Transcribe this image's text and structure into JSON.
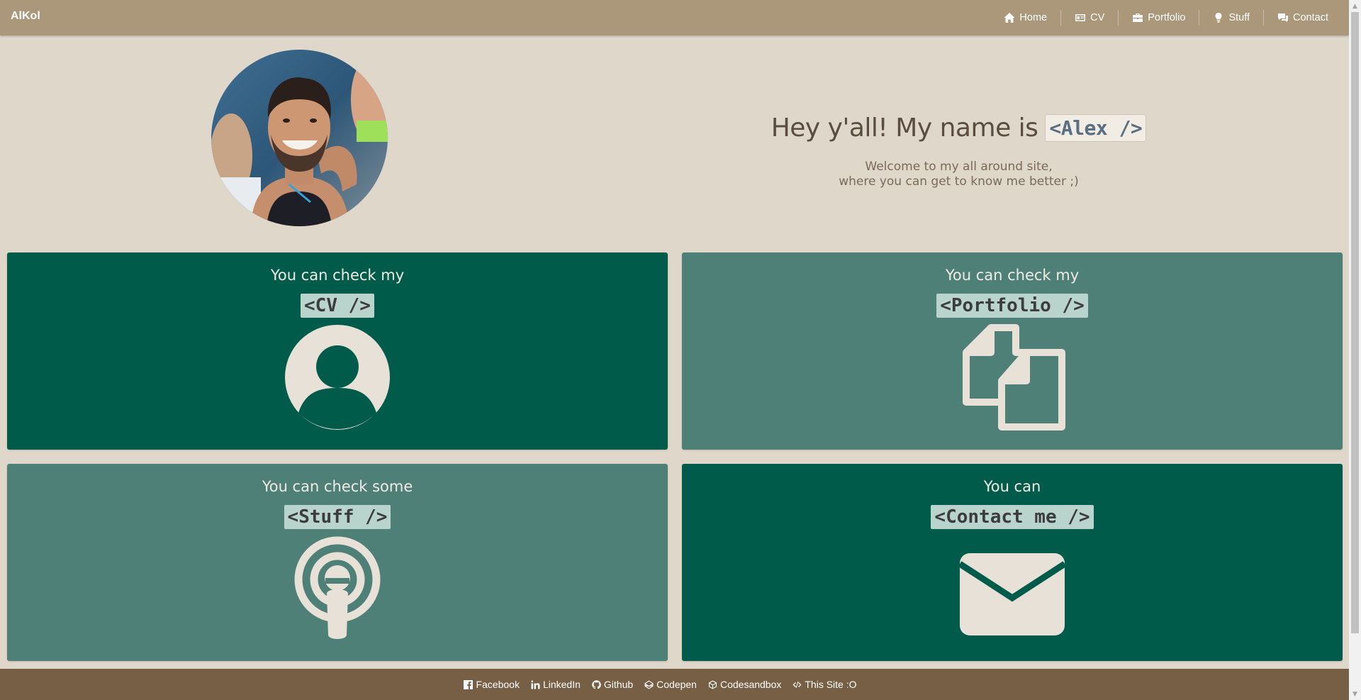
{
  "navbar": {
    "brand": "AlKol",
    "items": [
      {
        "label": "Home",
        "icon": "home-icon"
      },
      {
        "label": "CV",
        "icon": "id-card-icon"
      },
      {
        "label": "Portfolio",
        "icon": "briefcase-icon"
      },
      {
        "label": "Stuff",
        "icon": "lightbulb-icon"
      },
      {
        "label": "Contact",
        "icon": "comments-icon"
      }
    ]
  },
  "hero": {
    "title": "Hey y'all! My name is",
    "name_tag": "<Alex />",
    "subtitle_line1": "Welcome to my all around site,",
    "subtitle_line2": "where you can get to know me better ;)"
  },
  "cards": [
    {
      "heading": "You can check my",
      "tag": "<CV />",
      "icon": "user-circle-icon",
      "color": "#005b4a"
    },
    {
      "heading": "You can check my",
      "tag": "<Portfolio />",
      "icon": "copy-files-icon",
      "color": "#4f8078"
    },
    {
      "heading": "You can check some",
      "tag": "<Stuff />",
      "icon": "podcast-icon",
      "color": "#4f8078"
    },
    {
      "heading": "You can",
      "tag": "<Contact me />",
      "icon": "envelope-icon",
      "color": "#005b4a"
    }
  ],
  "footer": {
    "links": [
      {
        "label": "Facebook",
        "icon": "facebook-icon"
      },
      {
        "label": "LinkedIn",
        "icon": "linkedin-icon"
      },
      {
        "label": "Github",
        "icon": "github-icon"
      },
      {
        "label": "Codepen",
        "icon": "codepen-icon"
      },
      {
        "label": "Codesandbox",
        "icon": "codesandbox-icon"
      },
      {
        "label": "This Site :O",
        "icon": "code-icon"
      }
    ]
  },
  "colors": {
    "navbar": "#ab977a",
    "background": "#e0d7cb",
    "card_dark": "#005b4a",
    "card_light": "#4f8078",
    "footer": "#765f45"
  }
}
